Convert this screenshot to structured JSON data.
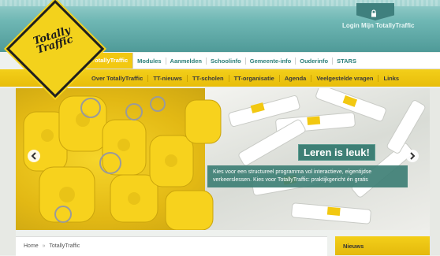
{
  "header": {
    "login_label": "Login Mijn TotallyTraffic",
    "logo_text_line1": "Totally",
    "logo_text_line2": "Traffic"
  },
  "main_nav": {
    "items": [
      {
        "label": "TotallyTraffic",
        "active": true
      },
      {
        "label": "Modules"
      },
      {
        "label": "Aanmelden"
      },
      {
        "label": "Schoolinfo"
      },
      {
        "label": "Gemeente-info"
      },
      {
        "label": "Ouderinfo"
      },
      {
        "label": "STARS"
      }
    ]
  },
  "sub_nav": {
    "items": [
      {
        "label": "Over TotallyTraffic"
      },
      {
        "label": "TT-nieuws"
      },
      {
        "label": "TT-scholen"
      },
      {
        "label": "TT-organisatie"
      },
      {
        "label": "Agenda"
      },
      {
        "label": "Veelgestelde vragen"
      },
      {
        "label": "Links"
      }
    ]
  },
  "hero": {
    "caption_title": "Leren is leuk!",
    "caption_text": "Kies voor een structureel programma vol interactieve, eigentijdse verkeerslessen. Kies voor TotallyTraffic: praktijkgericht én gratis"
  },
  "breadcrumb": {
    "home": "Home",
    "separator": "»",
    "current": "TotallyTraffic"
  },
  "news": {
    "title": "Nieuws"
  },
  "colors": {
    "brand_yellow": "#f2c811",
    "brand_teal": "#2a7f7a",
    "caption_green": "#3e7f75"
  },
  "icons": {
    "login": "lock-icon",
    "prev": "chevron-left-icon",
    "next": "chevron-right-icon"
  }
}
